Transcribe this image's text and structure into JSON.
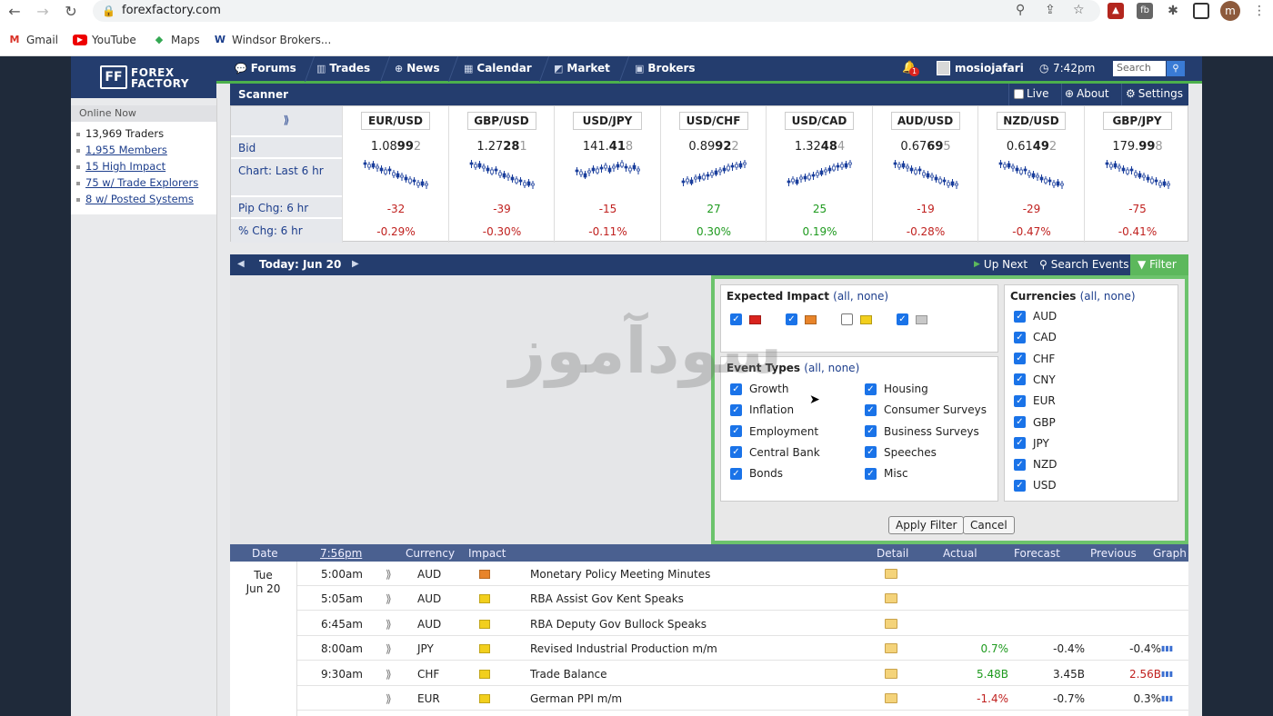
{
  "browser": {
    "url": "forexfactory.com",
    "profile_initial": "m",
    "bookmarks": [
      {
        "label": "Gmail",
        "icon": "gmail-icon"
      },
      {
        "label": "YouTube",
        "icon": "youtube-icon"
      },
      {
        "label": "Maps",
        "icon": "maps-icon"
      },
      {
        "label": "Windsor Brokers...",
        "icon": "windsor-icon"
      }
    ]
  },
  "site": {
    "logo": {
      "line1": "FOREX",
      "line2": "FACTORY"
    },
    "nav": [
      "Forums",
      "Trades",
      "News",
      "Calendar",
      "Market",
      "Brokers"
    ],
    "notifications": "1",
    "username": "mosiojafari",
    "time": "7:42pm",
    "search_placeholder": "Search"
  },
  "online": {
    "title": "Online Now",
    "items": [
      {
        "text": "13,969 Traders",
        "link": false
      },
      {
        "text": "1,955 Members",
        "link": true
      },
      {
        "text": "15 High Impact",
        "link": true
      },
      {
        "text": "75 w/ Trade Explorers",
        "link": true
      },
      {
        "text": "8 w/ Posted Systems",
        "link": true
      }
    ]
  },
  "scanner": {
    "title": "Scanner",
    "live": "Live",
    "about": "About",
    "settings": "Settings",
    "labels": {
      "bid": "Bid",
      "chart": "Chart: Last 6 hr",
      "pip": "Pip Chg: 6 hr",
      "pct": "% Chg: 6 hr"
    },
    "pairs": [
      {
        "name": "EUR/USD",
        "bid_a": "1.08",
        "bid_b": "99",
        "bid_c": "2",
        "pip": "-32",
        "pct": "-0.29%",
        "trend": "down"
      },
      {
        "name": "GBP/USD",
        "bid_a": "1.27",
        "bid_b": "28",
        "bid_c": "1",
        "pip": "-39",
        "pct": "-0.30%",
        "trend": "down"
      },
      {
        "name": "USD/JPY",
        "bid_a": "141.",
        "bid_b": "41",
        "bid_c": "8",
        "pip": "-15",
        "pct": "-0.11%",
        "trend": "flat"
      },
      {
        "name": "USD/CHF",
        "bid_a": "0.89",
        "bid_b": "92",
        "bid_c": "2",
        "pip": "27",
        "pct": "0.30%",
        "trend": "up"
      },
      {
        "name": "USD/CAD",
        "bid_a": "1.32",
        "bid_b": "48",
        "bid_c": "4",
        "pip": "25",
        "pct": "0.19%",
        "trend": "up"
      },
      {
        "name": "AUD/USD",
        "bid_a": "0.67",
        "bid_b": "69",
        "bid_c": "5",
        "pip": "-19",
        "pct": "-0.28%",
        "trend": "down"
      },
      {
        "name": "NZD/USD",
        "bid_a": "0.61",
        "bid_b": "49",
        "bid_c": "2",
        "pip": "-29",
        "pct": "-0.47%",
        "trend": "down"
      },
      {
        "name": "GBP/JPY",
        "bid_a": "179.",
        "bid_b": "99",
        "bid_c": "8",
        "pip": "-75",
        "pct": "-0.41%",
        "trend": "down"
      }
    ]
  },
  "calendar": {
    "today": "Today: Jun 20",
    "up_next": "Up Next",
    "search_events": "Search Events",
    "filter": "Filter"
  },
  "filter": {
    "impact_title": "Expected Impact",
    "all": "all",
    "none": "none",
    "impacts": [
      {
        "color": "#d9231e",
        "checked": true
      },
      {
        "color": "#e8842a",
        "checked": true
      },
      {
        "color": "#f2cf1d",
        "checked": false
      },
      {
        "color": "#c8c8c8",
        "checked": true
      }
    ],
    "types_title": "Event Types",
    "types_left": [
      "Growth",
      "Inflation",
      "Employment",
      "Central Bank",
      "Bonds"
    ],
    "types_right": [
      "Housing",
      "Consumer Surveys",
      "Business Surveys",
      "Speeches",
      "Misc"
    ],
    "currencies_title": "Currencies",
    "currencies": [
      "AUD",
      "CAD",
      "CHF",
      "CNY",
      "EUR",
      "GBP",
      "JPY",
      "NZD",
      "USD"
    ],
    "apply": "Apply Filter",
    "cancel": "Cancel"
  },
  "table": {
    "headers": {
      "date": "Date",
      "time": "7:56pm",
      "currency": "Currency",
      "impact": "Impact",
      "detail": "Detail",
      "actual": "Actual",
      "forecast": "Forecast",
      "previous": "Previous",
      "graph": "Graph"
    },
    "date_day": "Tue",
    "date_md": "Jun 20",
    "rows": [
      {
        "time": "5:00am",
        "cur": "AUD",
        "impact": "#e8842a",
        "event": "Monetary Policy Meeting Minutes",
        "actual": "",
        "forecast": "",
        "previous": "",
        "graph": false
      },
      {
        "time": "5:05am",
        "cur": "AUD",
        "impact": "#f2cf1d",
        "event": "RBA Assist Gov Kent Speaks",
        "actual": "",
        "forecast": "",
        "previous": "",
        "graph": false
      },
      {
        "time": "6:45am",
        "cur": "AUD",
        "impact": "#f2cf1d",
        "event": "RBA Deputy Gov Bullock Speaks",
        "actual": "",
        "forecast": "",
        "previous": "",
        "graph": false
      },
      {
        "time": "8:00am",
        "cur": "JPY",
        "impact": "#f2cf1d",
        "event": "Revised Industrial Production m/m",
        "actual": "0.7%",
        "actual_class": "pos",
        "forecast": "-0.4%",
        "previous": "-0.4%",
        "graph": true
      },
      {
        "time": "9:30am",
        "cur": "CHF",
        "impact": "#f2cf1d",
        "event": "Trade Balance",
        "actual": "5.48B",
        "actual_class": "pos",
        "forecast": "3.45B",
        "previous": "2.56B",
        "prev_class": "neg",
        "graph": true
      },
      {
        "time": "",
        "cur": "EUR",
        "impact": "#f2cf1d",
        "event": "German PPI m/m",
        "actual": "-1.4%",
        "actual_class": "neg",
        "forecast": "-0.7%",
        "previous": "0.3%",
        "graph": true
      }
    ]
  },
  "watermark": "سودآموز"
}
